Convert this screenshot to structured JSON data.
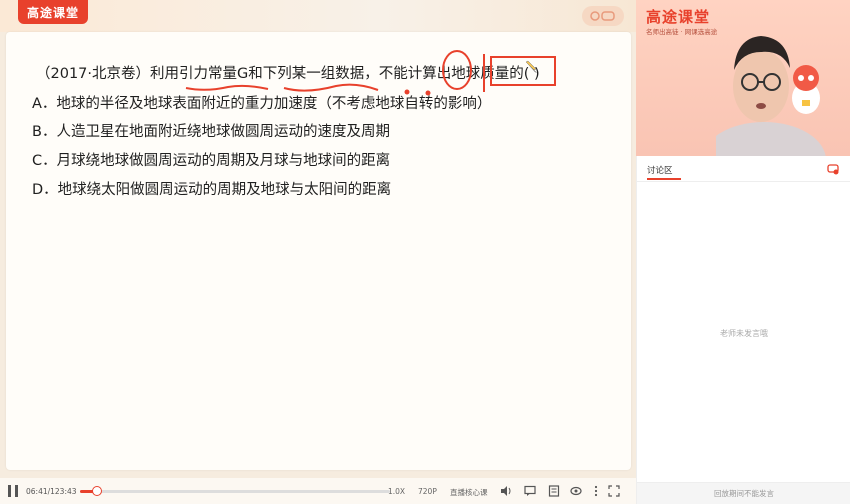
{
  "header": {
    "logo_text": "高途课堂"
  },
  "slide": {
    "question": "（2017·北京卷）利用引力常量G和下列某一组数据，不能计算出地球质量的( )",
    "options": [
      "A．地球的半径及地球表面附近的重力加速度（不考虑地球自转的影响）",
      "B．人造卫星在地面附近绕地球做圆周运动的速度及周期",
      "C．月球绕地球做圆周运动的周期及月球与地球间的距离",
      "D．地球绕太阳做圆周运动的周期及地球与太阳间的距离"
    ]
  },
  "player": {
    "time": "06:41/123:43",
    "progress_fraction": 0.054,
    "speed": "1.0X",
    "quality": "720P",
    "core_label": "直播核心课"
  },
  "video": {
    "brand": "高途课堂",
    "slogan": "名师出高徒 · 网课选高途"
  },
  "discussion": {
    "title": "讨论区",
    "empty_message": "老师未发言哦",
    "input_disabled": "回放期间不能发言"
  },
  "colors": {
    "accent": "#e8412c",
    "annotation": "#e8412c"
  },
  "icons": {
    "pause": "pause-icon",
    "volume": "volume-icon",
    "danmaku": "danmaku-icon",
    "note": "note-icon",
    "screenshot": "screenshot-icon",
    "eye": "eye-icon",
    "more": "more-icon",
    "fullscreen": "fullscreen-icon",
    "pen": "pen-icon",
    "settings": "settings-icon"
  }
}
